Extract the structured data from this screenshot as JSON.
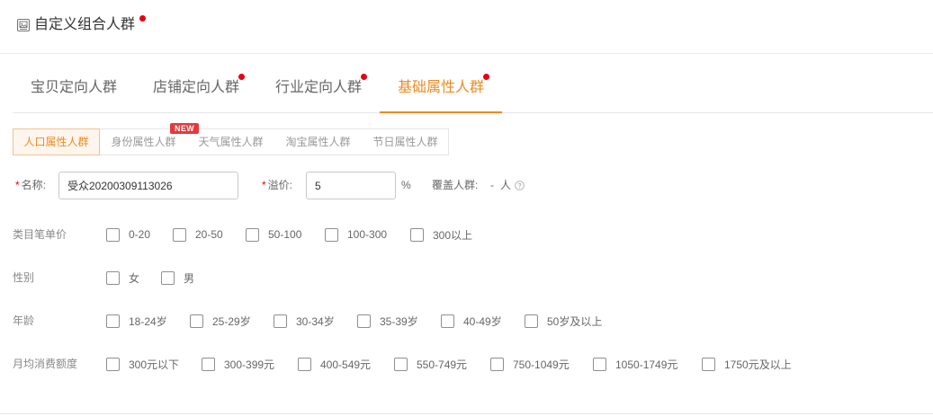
{
  "header": {
    "title": "自定义组合人群",
    "icon": "image-icon",
    "notification_dot": true
  },
  "tabs": [
    {
      "label": "宝贝定向人群",
      "active": false,
      "notification_dot": false
    },
    {
      "label": "店铺定向人群",
      "active": false,
      "notification_dot": true
    },
    {
      "label": "行业定向人群",
      "active": false,
      "notification_dot": true
    },
    {
      "label": "基础属性人群",
      "active": true,
      "notification_dot": true
    }
  ],
  "subtabs": [
    {
      "label": "人口属性人群",
      "active": true
    },
    {
      "label": "身份属性人群",
      "active": false,
      "badge": "NEW"
    },
    {
      "label": "天气属性人群",
      "active": false
    },
    {
      "label": "淘宝属性人群",
      "active": false
    },
    {
      "label": "节日属性人群",
      "active": false
    }
  ],
  "form": {
    "required_mark": "*",
    "name": {
      "label": "名称:",
      "value": "受众20200309113026"
    },
    "premium": {
      "label": "溢价:",
      "value": "5",
      "unit": "%"
    },
    "coverage": {
      "label": "覆盖人群:",
      "value": "-",
      "unit": "人",
      "help_icon": "question-circle-icon"
    }
  },
  "filters": [
    {
      "label": "类目笔单价",
      "options": [
        {
          "label": "0-20",
          "checked": false
        },
        {
          "label": "20-50",
          "checked": false
        },
        {
          "label": "50-100",
          "checked": false
        },
        {
          "label": "100-300",
          "checked": false
        },
        {
          "label": "300以上",
          "checked": false
        }
      ]
    },
    {
      "label": "性别",
      "options": [
        {
          "label": "女",
          "checked": false
        },
        {
          "label": "男",
          "checked": false
        }
      ]
    },
    {
      "label": "年龄",
      "options": [
        {
          "label": "18-24岁",
          "checked": false
        },
        {
          "label": "25-29岁",
          "checked": false
        },
        {
          "label": "30-34岁",
          "checked": false
        },
        {
          "label": "35-39岁",
          "checked": false
        },
        {
          "label": "40-49岁",
          "checked": false
        },
        {
          "label": "50岁及以上",
          "checked": false
        }
      ]
    },
    {
      "label": "月均消费额度",
      "options": [
        {
          "label": "300元以下",
          "checked": false
        },
        {
          "label": "300-399元",
          "checked": false
        },
        {
          "label": "400-549元",
          "checked": false
        },
        {
          "label": "550-749元",
          "checked": false
        },
        {
          "label": "750-1049元",
          "checked": false
        },
        {
          "label": "1050-1749元",
          "checked": false
        },
        {
          "label": "1750元及以上",
          "checked": false
        }
      ]
    }
  ],
  "colors": {
    "accent": "#ef8a1e",
    "notification_dot": "#e60012",
    "new_badge": "#e4393c",
    "accent_bg": "#fef6ee"
  }
}
